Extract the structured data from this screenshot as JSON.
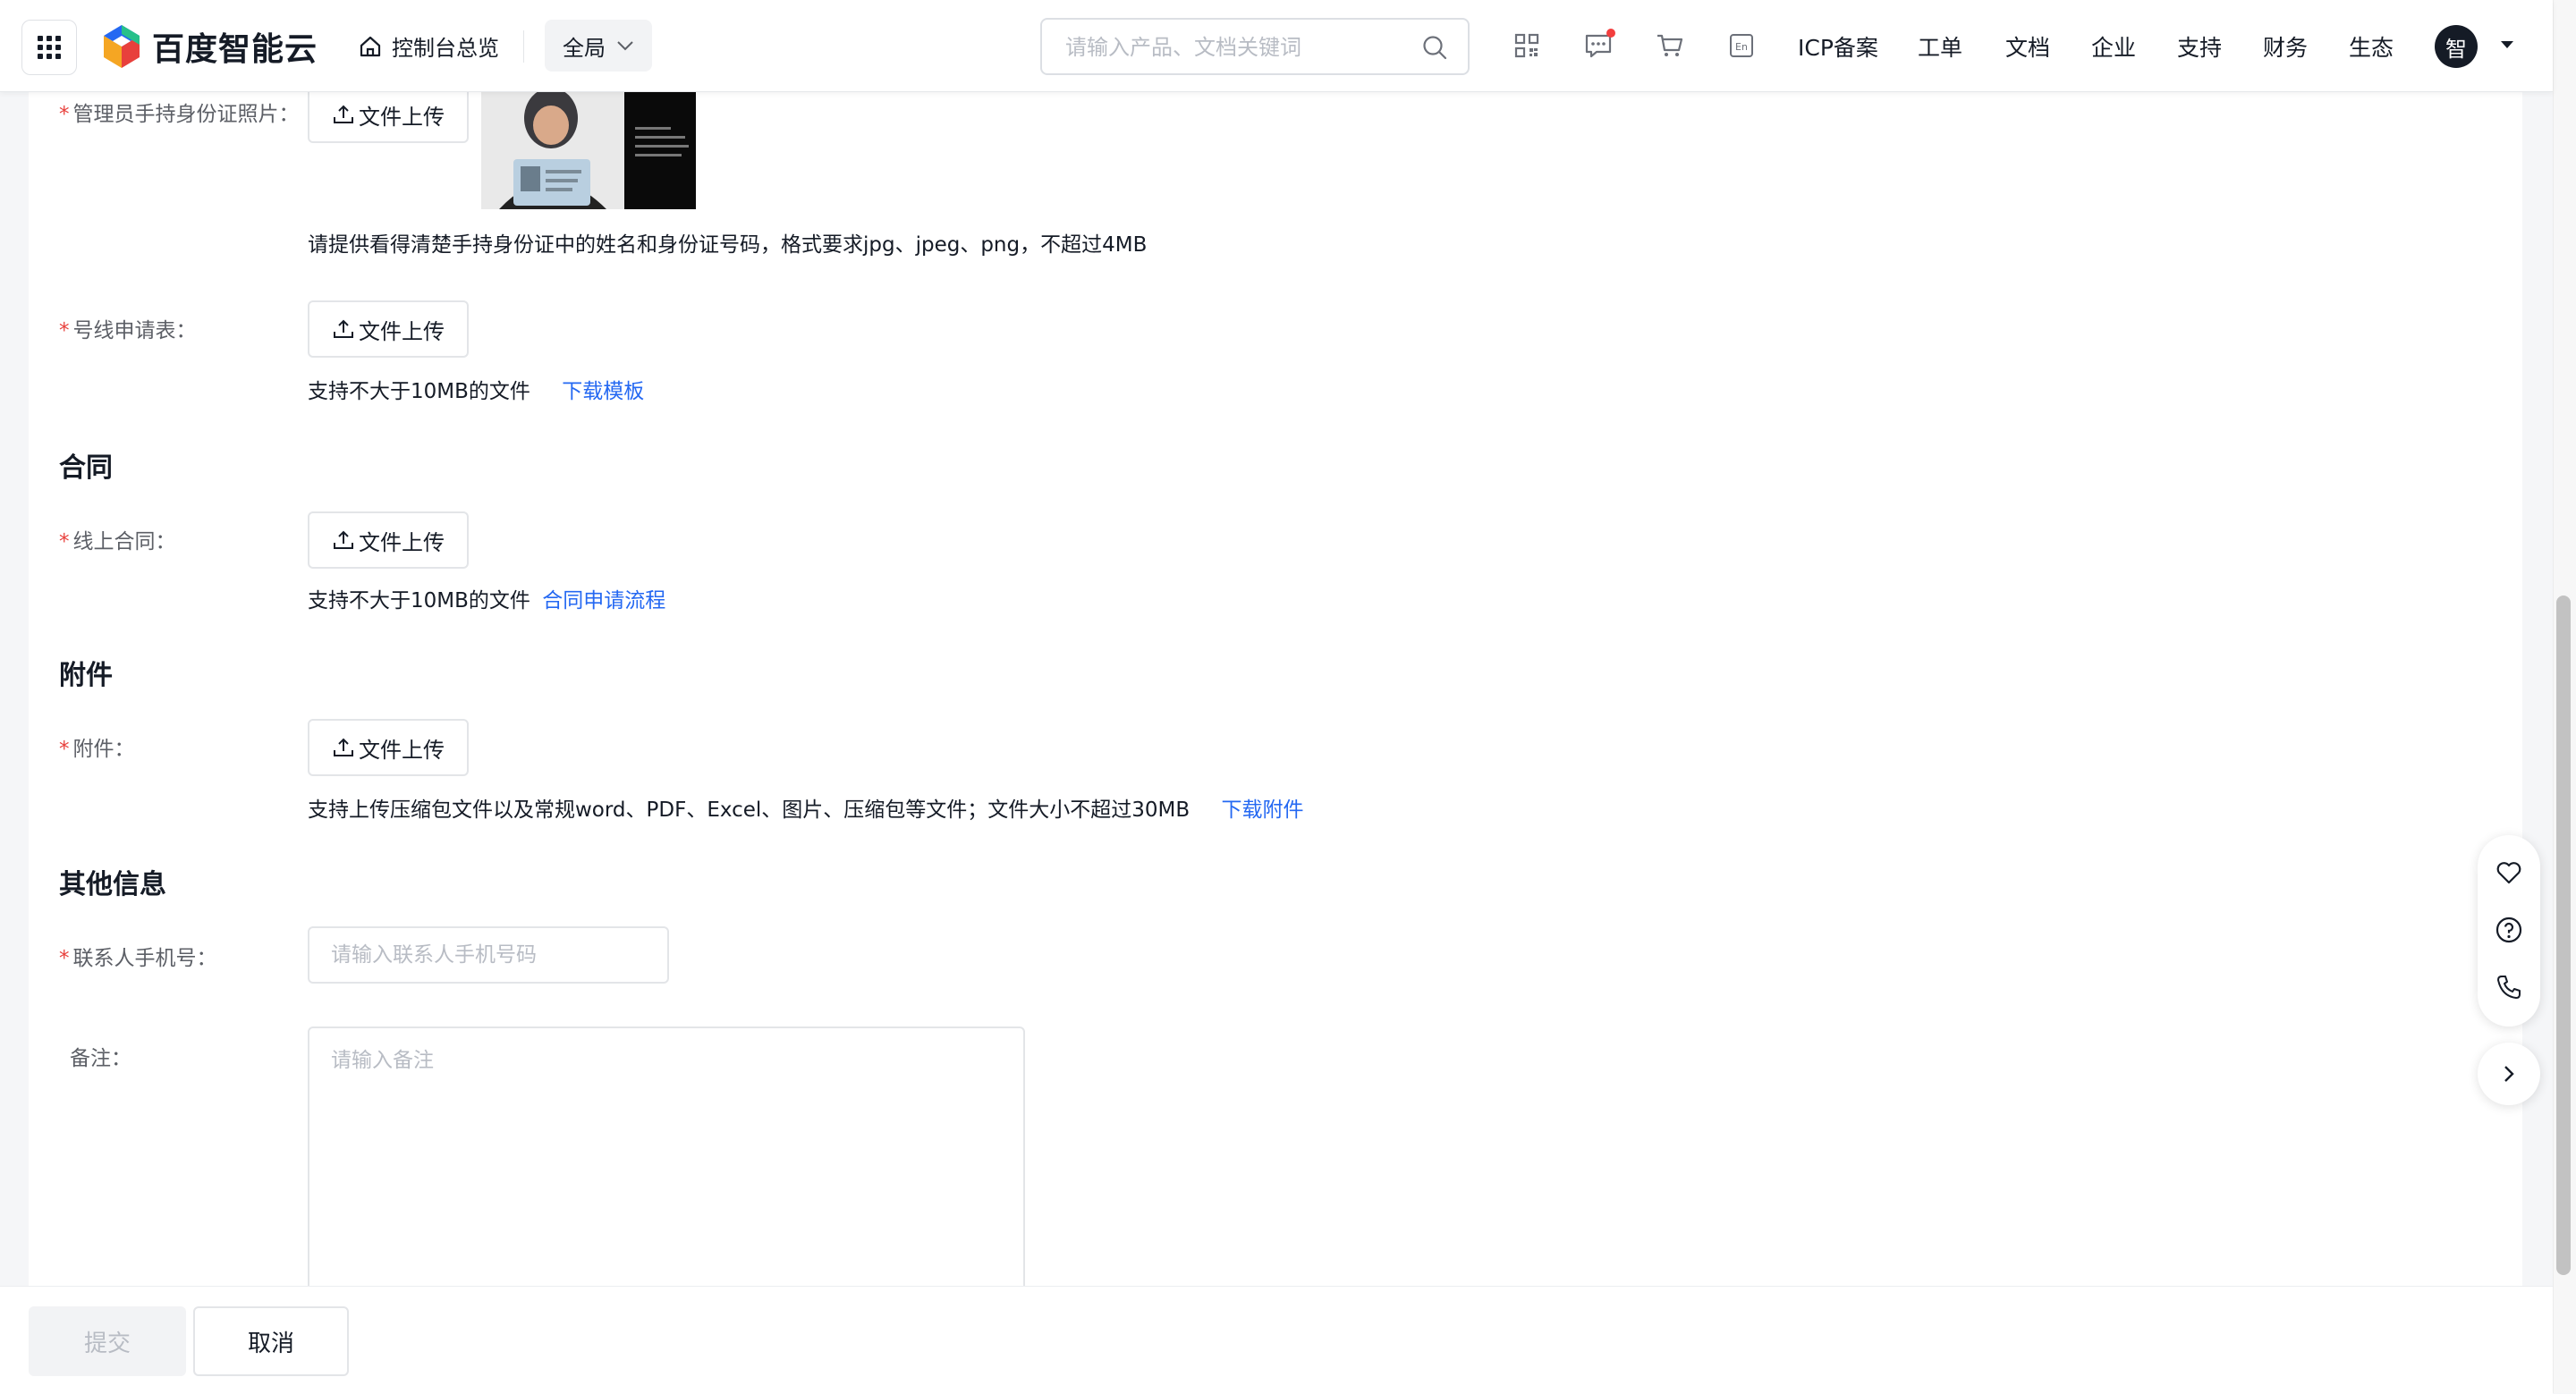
{
  "header": {
    "logo_text": "百度智能云",
    "console_label": "控制台总览",
    "region_label": "全局",
    "search_placeholder": "请输入产品、文档关键词",
    "lang_icon_text": "En",
    "nav": [
      "ICP备案",
      "工单",
      "文档",
      "企业",
      "支持",
      "财务",
      "生态"
    ],
    "avatar_text": "智"
  },
  "form": {
    "admin_photo": {
      "label": "管理员手持身份证照片：",
      "upload_label": "文件上传",
      "hint": "请提供看得清楚手持身份证中的姓名和身份证号码，格式要求jpg、jpeg、png，不超过4MB"
    },
    "line_form": {
      "label": "号线申请表：",
      "upload_label": "文件上传",
      "hint": "支持不大于10MB的文件",
      "link": "下载模板"
    },
    "contract_section": "合同",
    "contract": {
      "label": "线上合同：",
      "upload_label": "文件上传",
      "hint": "支持不大于10MB的文件",
      "link": "合同申请流程"
    },
    "attachment_section": "附件",
    "attachment": {
      "label": "附件：",
      "upload_label": "文件上传",
      "hint": "支持上传压缩包文件以及常规word、PDF、Excel、图片、压缩包等文件；文件大小不超过30MB",
      "link": "下载附件"
    },
    "other_section": "其他信息",
    "phone": {
      "label": "联系人手机号：",
      "placeholder": "请输入联系人手机号码",
      "value": ""
    },
    "remark": {
      "label": "备注：",
      "placeholder": "请输入备注",
      "value": ""
    }
  },
  "footer": {
    "submit_label": "提交",
    "cancel_label": "取消"
  },
  "colors": {
    "link": "#2468f2",
    "required": "#e8403c",
    "notification_dot": "#f33e3e"
  }
}
